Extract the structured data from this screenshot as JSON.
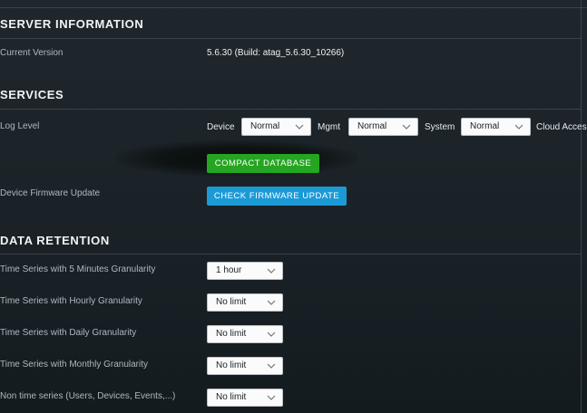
{
  "server_info": {
    "title": "SERVER INFORMATION",
    "current_version_label": "Current Version",
    "current_version_value": "5.6.30 (Build: atag_5.6.30_10266)"
  },
  "services": {
    "title": "SERVICES",
    "log_level_label": "Log Level",
    "device_label": "Device",
    "device_value": "Normal",
    "mgmt_label": "Mgmt",
    "mgmt_value": "Normal",
    "system_label": "System",
    "system_value": "Normal",
    "cloud_access_label": "Cloud Acces",
    "compact_database_button": "COMPACT DATABASE",
    "firmware_update_label": "Device Firmware Update",
    "check_firmware_button": "CHECK FIRMWARE UPDATE"
  },
  "data_retention": {
    "title": "DATA RETENTION",
    "rows": [
      {
        "label": "Time Series with 5 Minutes Granularity",
        "value": "1 hour"
      },
      {
        "label": "Time Series with Hourly Granularity",
        "value": "No limit"
      },
      {
        "label": "Time Series with Daily Granularity",
        "value": "No limit"
      },
      {
        "label": "Time Series with Monthly Granularity",
        "value": "No limit"
      },
      {
        "label": "Non time series (Users, Devices, Events,...)",
        "value": "No limit"
      }
    ]
  },
  "colors": {
    "green_button": "#25a521",
    "blue_button": "#1b9ad6",
    "background": "#1c2429"
  },
  "icons": {
    "select_arrow": "chevron-down-icon"
  }
}
